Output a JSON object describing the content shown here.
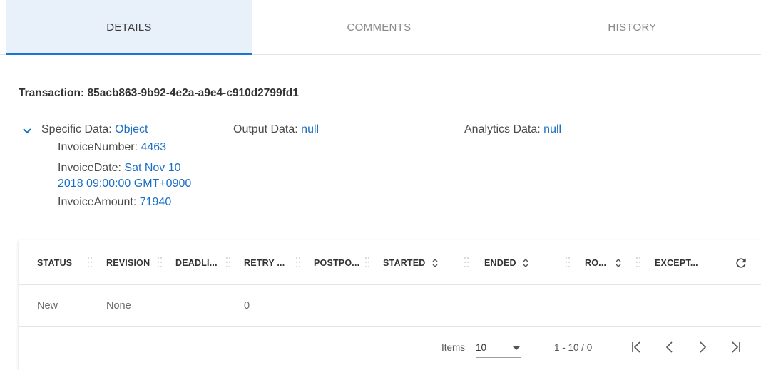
{
  "tabs": [
    {
      "label": "DETAILS",
      "active": true
    },
    {
      "label": "COMMENTS",
      "active": false
    },
    {
      "label": "HISTORY",
      "active": false
    }
  ],
  "transaction": {
    "title": "Transaction: 85acb863-9b92-4e2a-a9e4-c910d2799fd1"
  },
  "specific_data": {
    "key": "Specific Data:",
    "value": "Object",
    "expanded": true,
    "fields": {
      "invoice_number_key": "InvoiceNumber:",
      "invoice_number_value": "4463",
      "invoice_date_key": "InvoiceDate:",
      "invoice_date_value_line1": "Sat Nov 10",
      "invoice_date_value_line2": "2018 09:00:00 GMT+0900",
      "invoice_amount_key": "InvoiceAmount:",
      "invoice_amount_value": "71940"
    }
  },
  "output_data": {
    "key": "Output Data:",
    "value": "null"
  },
  "analytics_data": {
    "key": "Analytics Data:",
    "value": "null"
  },
  "table": {
    "columns": [
      "STATUS",
      "REVISION",
      "DEADLI...",
      "RETRY ...",
      "POSTPO...",
      "STARTED",
      "ENDED",
      "RO...",
      "EXCEPT..."
    ],
    "rows": [
      {
        "status": "New",
        "revision": "None",
        "retry": "0"
      }
    ]
  },
  "pagination": {
    "items_label": "Items",
    "page_size": "10",
    "range": "1 - 10 / 0"
  },
  "colors": {
    "accent": "#1976d2",
    "link": "#1a6fc4",
    "tab_active_bg": "#e8f1fa"
  },
  "icons": [
    "chevron-down-icon",
    "sort-icon",
    "refresh-icon",
    "first-page-icon",
    "prev-page-icon",
    "next-page-icon",
    "last-page-icon"
  ]
}
